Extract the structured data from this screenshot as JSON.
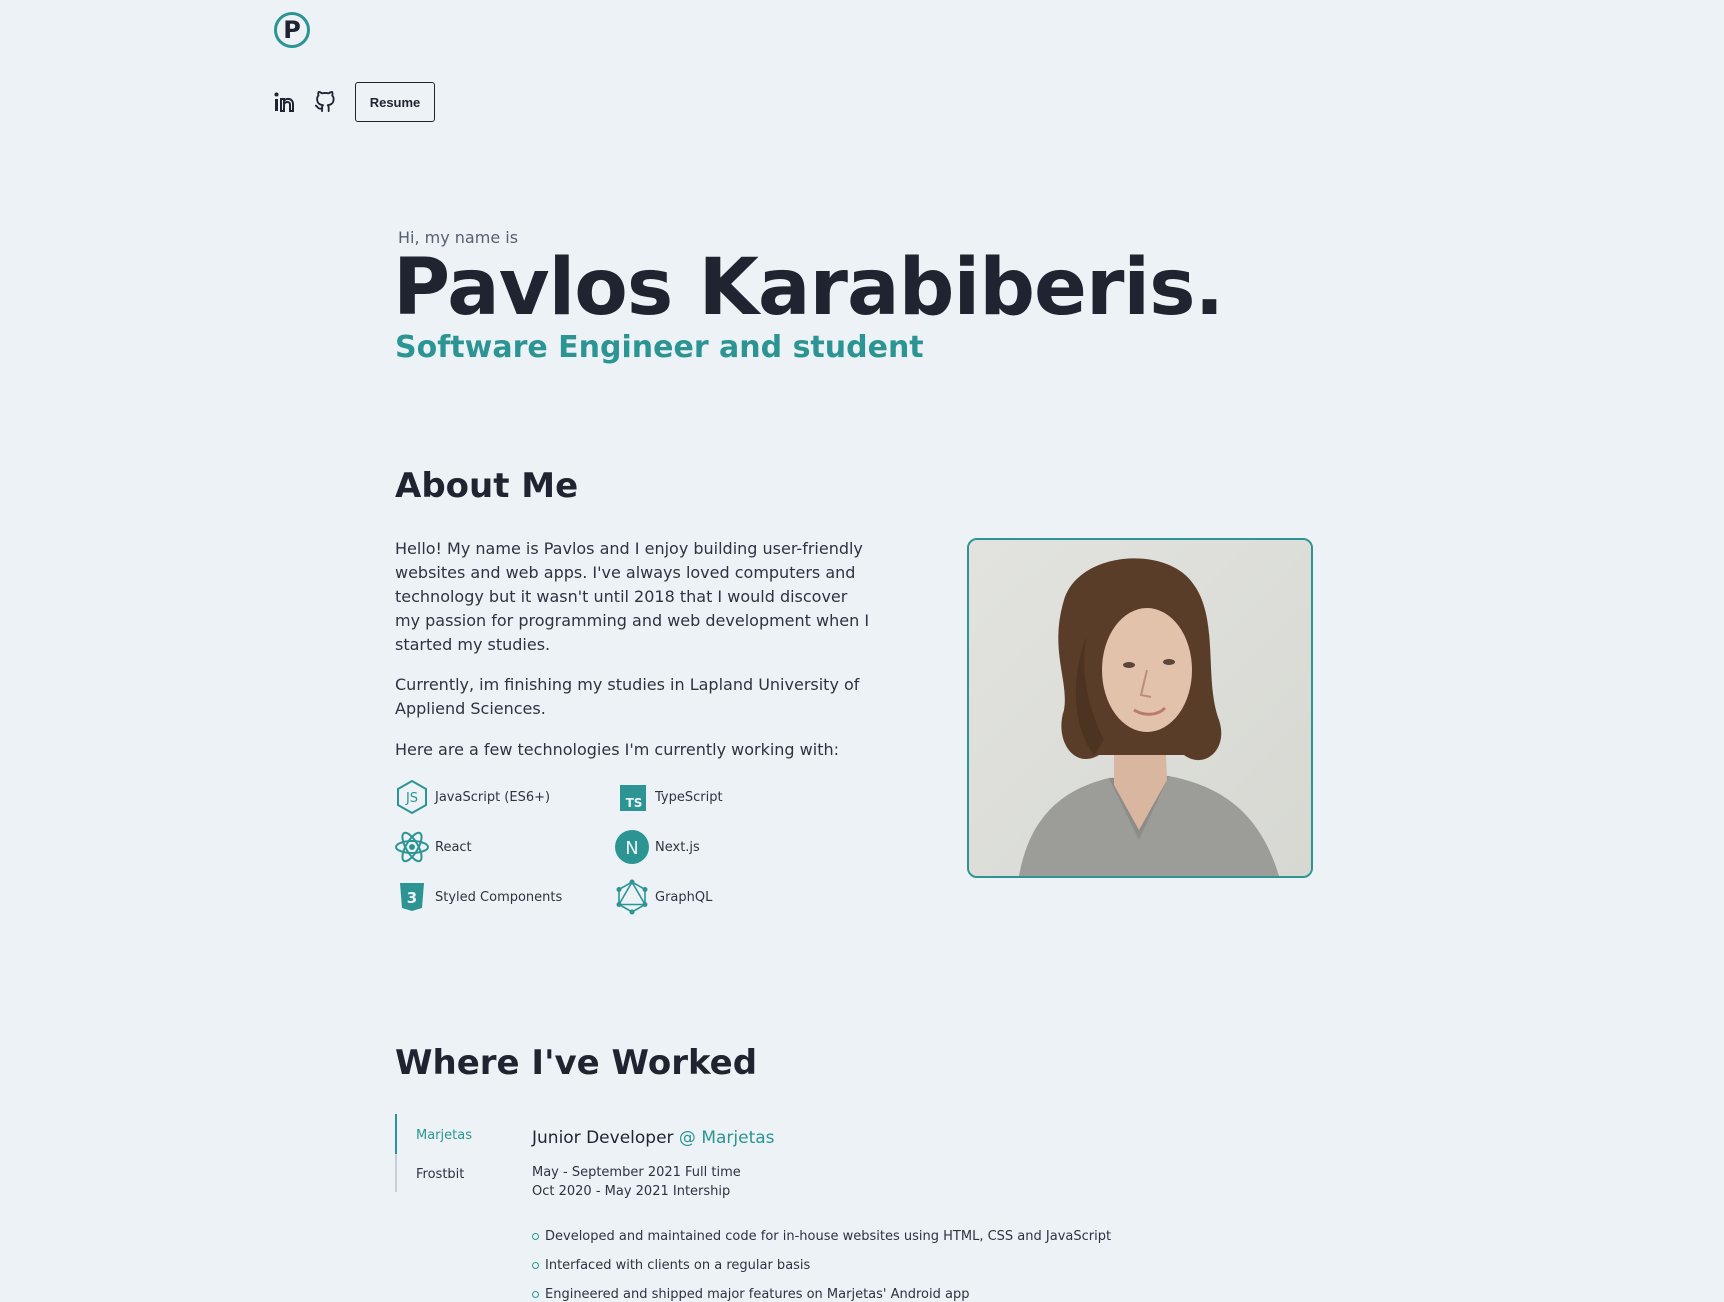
{
  "header": {
    "logo_letter": "P",
    "social": [
      {
        "icon": "linkedin-icon"
      },
      {
        "icon": "github-icon"
      }
    ],
    "resume_label": "Resume"
  },
  "hero": {
    "greeting": "Hi, my name is",
    "name": "Pavlos Karabiberis.",
    "role": "Software Engineer and student"
  },
  "about": {
    "title": "About Me",
    "paragraphs": [
      "Hello! My name is Pavlos and I enjoy building user-friendly websites and web apps. I've always loved computers and technology but it wasn't until 2018 that I would discover my passion for programming and web development when I started my studies.",
      "Currently, im finishing my studies in Lapland University of Appliend Sciences.",
      "Here are a few technologies I'm currently working with:"
    ],
    "technologies": [
      {
        "label": "JavaScript (ES6+)",
        "icon": "javascript-icon"
      },
      {
        "label": "TypeScript",
        "icon": "typescript-icon"
      },
      {
        "label": "React",
        "icon": "react-icon"
      },
      {
        "label": "Next.js",
        "icon": "nextjs-icon"
      },
      {
        "label": "Styled Components",
        "icon": "css3-icon"
      },
      {
        "label": "GraphQL",
        "icon": "graphql-icon"
      }
    ],
    "photo_alt": "portrait photo"
  },
  "work": {
    "title": "Where I've Worked",
    "tabs": [
      "Marjetas",
      "Frostbit"
    ],
    "active_tab": "Marjetas",
    "job": {
      "title": "Junior Developer",
      "company": "@ Marjetas",
      "dates": [
        "May - September 2021 Full time",
        "Oct 2020 - May 2021 Intership"
      ],
      "bullets": [
        "Developed and maintained code for in-house websites using HTML, CSS and JavaScript",
        "Interfaced with clients on a regular basis",
        "Engineered and shipped major features on Marjetas' Android app"
      ]
    }
  },
  "colors": {
    "accent": "#2c9593",
    "background": "#edf2f6",
    "text": "#1f2430"
  }
}
